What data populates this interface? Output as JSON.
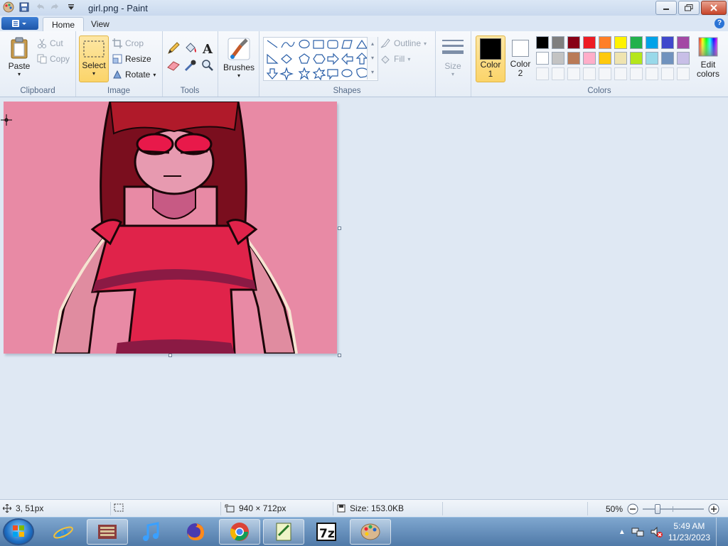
{
  "window": {
    "title": "girl.png - Paint"
  },
  "tabs": {
    "home": "Home",
    "view": "View"
  },
  "clipboard": {
    "paste": "Paste",
    "cut": "Cut",
    "copy": "Copy",
    "label": "Clipboard"
  },
  "image": {
    "select": "Select",
    "crop": "Crop",
    "resize": "Resize",
    "rotate": "Rotate",
    "label": "Image"
  },
  "tools": {
    "label": "Tools"
  },
  "brushes": {
    "label": "Brushes"
  },
  "shapes": {
    "outline": "Outline",
    "fill": "Fill",
    "label": "Shapes"
  },
  "size": {
    "label": "Size"
  },
  "colors": {
    "color1_l1": "Color",
    "color1_l2": "1",
    "color2_l1": "Color",
    "color2_l2": "2",
    "edit_l1": "Edit",
    "edit_l2": "colors",
    "label": "Colors",
    "color1_value": "#000000",
    "color2_value": "#ffffff",
    "row1": [
      "#000000",
      "#7f7f7f",
      "#880015",
      "#ed1c24",
      "#ff7f27",
      "#fff200",
      "#22b14c",
      "#00a2e8",
      "#3f48cc",
      "#a349a4"
    ],
    "row2": [
      "#ffffff",
      "#c3c3c3",
      "#b97a57",
      "#ffaec9",
      "#ffc90e",
      "#efe4b0",
      "#b5e61d",
      "#99d9ea",
      "#7092be",
      "#c8bfe7"
    ]
  },
  "status": {
    "cursor_pos": "3, 51px",
    "dimensions": "940 × 712px",
    "filesize": "Size: 153.0KB",
    "zoom": "50%"
  },
  "taskbar": {
    "time": "5:49 AM",
    "date": "11/23/2023"
  }
}
